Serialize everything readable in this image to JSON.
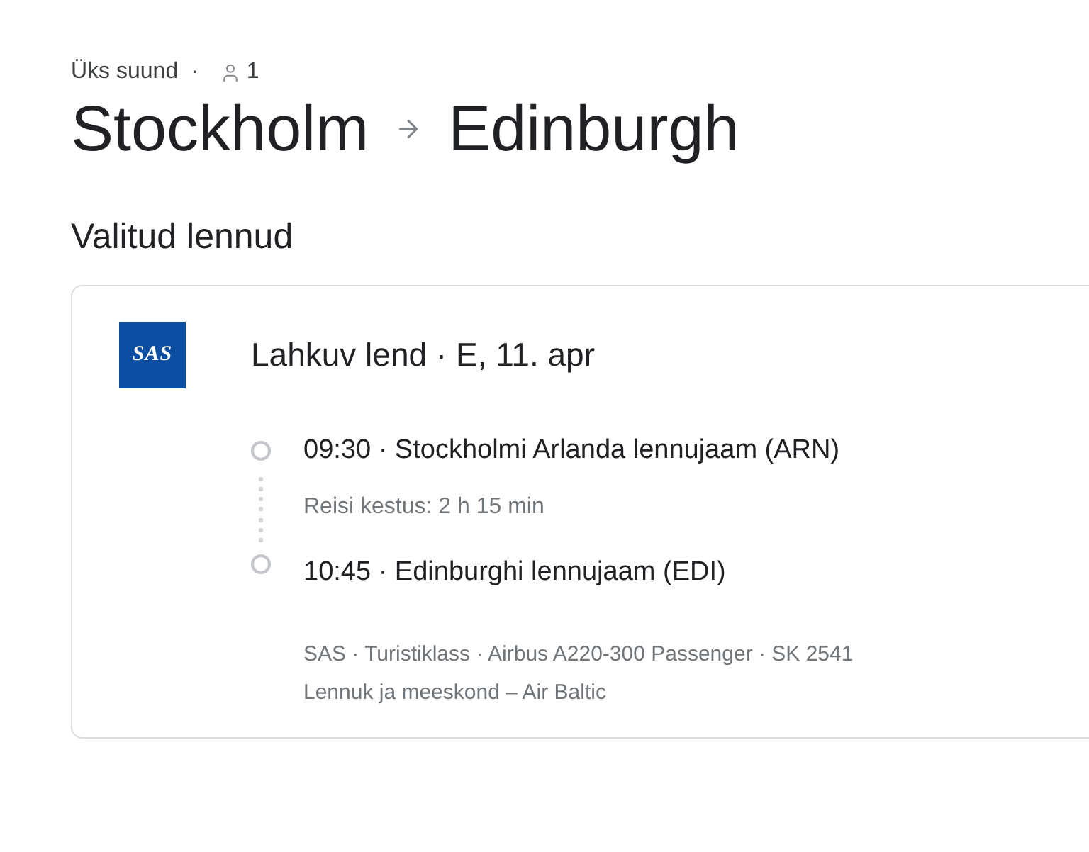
{
  "header": {
    "trip_type": "Üks suund",
    "separator": "·",
    "passengers": "1"
  },
  "route": {
    "origin": "Stockholm",
    "destination": "Edinburgh"
  },
  "section_title": "Valitud lennud",
  "flight_card": {
    "airline_logo": "SAS",
    "heading": "Lahkuv lend · E, 11. apr",
    "stops": [
      "09:30 · Stockholmi Arlanda lennujaam (ARN)",
      "10:45 · Edinburghi lennujaam (EDI)"
    ],
    "duration": "Reisi kestus: 2 h 15 min",
    "details": "SAS · Turistiklass · Airbus A220-300 Passenger · SK 2541",
    "operator": "Lennuk ja meeskond – Air Baltic"
  }
}
